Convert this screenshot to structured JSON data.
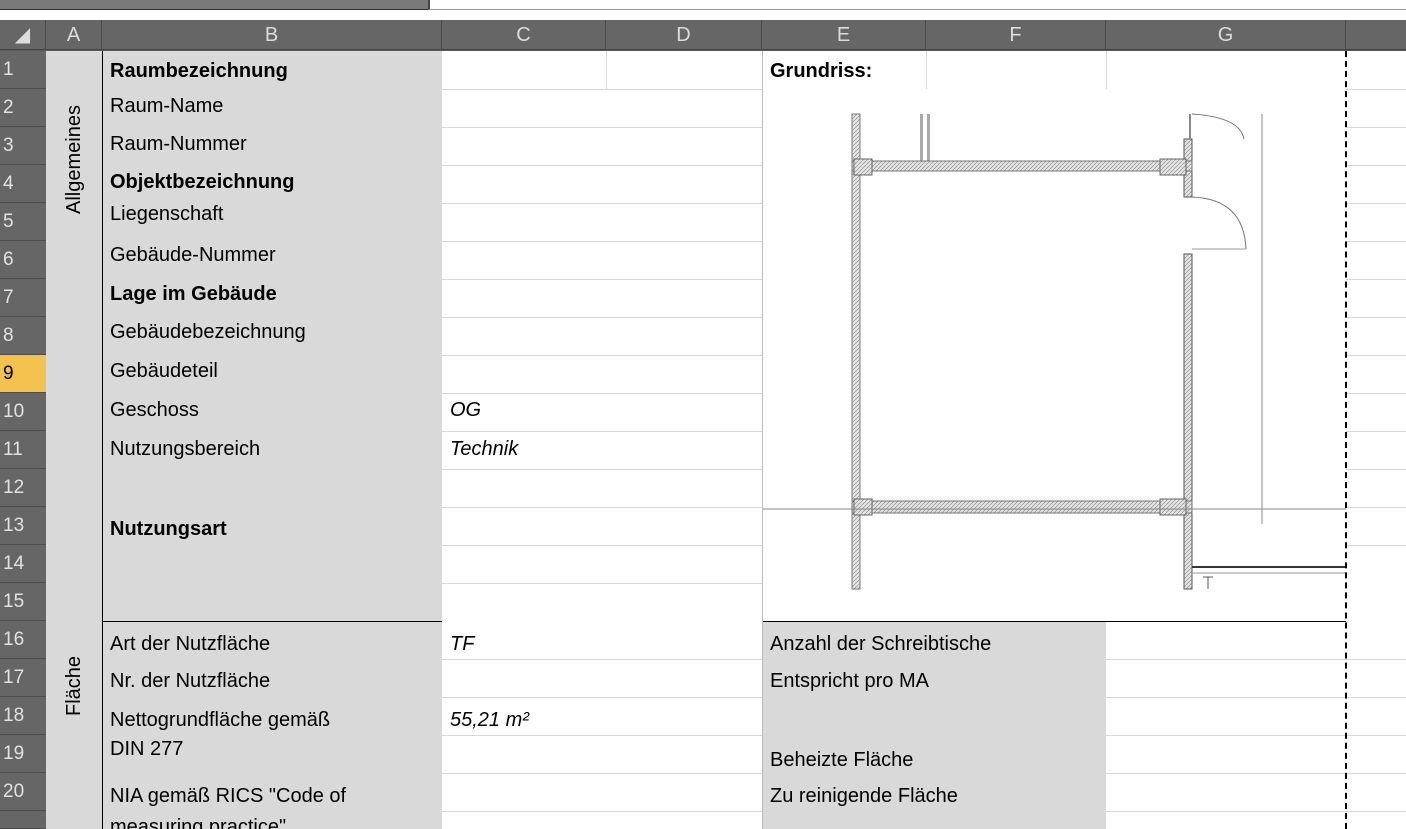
{
  "columns": [
    "A",
    "B",
    "C",
    "D",
    "E",
    "F",
    "G"
  ],
  "rows": [
    "1",
    "2",
    "3",
    "4",
    "5",
    "6",
    "7",
    "8",
    "9",
    "10",
    "11",
    "12",
    "13",
    "14",
    "15",
    "16",
    "17",
    "18",
    "19",
    "20"
  ],
  "selected_row": "9",
  "section_labels": {
    "allgemeines": "Allgemeines",
    "flaeche": "Fläche"
  },
  "labels": {
    "r1": "Raumbezeichnung",
    "r2": "Raum-Name",
    "r3": "Raum-Nummer",
    "r4": "Objektbezeichnung",
    "r5": "Liegenschaft",
    "r6": "Gebäude-Nummer",
    "r7": "Lage im Gebäude",
    "r8": "Gebäudebezeichnung",
    "r9": "Gebäudeteil",
    "r10": "Geschoss",
    "r11": "Nutzungsbereich",
    "r13": "Nutzungsart",
    "r16": "Art der Nutzfläche",
    "r17": "Nr. der Nutzfläche",
    "r18": "Nettogrundfläche gemäß",
    "r19": "DIN 277",
    "r20": "NIA gemäß RICS \"Code of",
    "r21": "measuring practice\""
  },
  "values": {
    "r10": "OG",
    "r11": "Technik",
    "r16": "TF",
    "r18": "55,21 m²"
  },
  "right_labels": {
    "grundriss": "Grundriss:",
    "r16": "Anzahl der Schreibtische",
    "r17": "Entspricht pro MA",
    "r19": "Beheizte Fläche",
    "r20": "Zu reinigende Fläche"
  },
  "colors": {
    "row_header_selected": "#f2c14e",
    "label_fill": "#d9d9d9",
    "header_fill": "#666666"
  }
}
